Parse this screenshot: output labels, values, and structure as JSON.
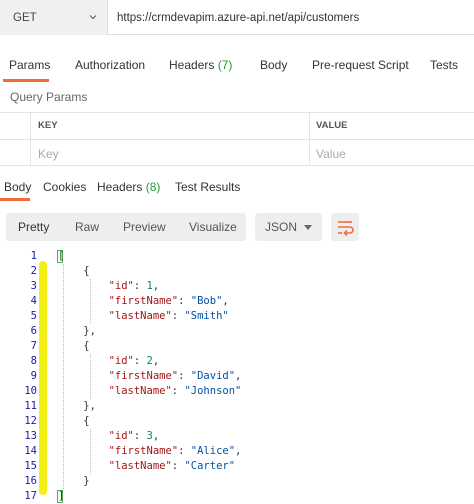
{
  "request": {
    "method": "GET",
    "url": "https://crmdevapim.azure-api.net/api/customers"
  },
  "request_tabs": [
    {
      "label": "Params"
    },
    {
      "label": "Authorization"
    },
    {
      "label": "Headers",
      "count": "(7)"
    },
    {
      "label": "Body"
    },
    {
      "label": "Pre-request Script"
    },
    {
      "label": "Tests"
    }
  ],
  "query_params": {
    "title": "Query Params",
    "columns": [
      "KEY",
      "VALUE"
    ],
    "placeholders": {
      "key": "Key",
      "value": "Value"
    }
  },
  "response_tabs": [
    {
      "label": "Body"
    },
    {
      "label": "Cookies"
    },
    {
      "label": "Headers",
      "count": "(8)"
    },
    {
      "label": "Test Results"
    }
  ],
  "view_modes": [
    "Pretty",
    "Raw",
    "Preview",
    "Visualize"
  ],
  "format": "JSON",
  "line_numbers": [
    "1",
    "2",
    "3",
    "4",
    "5",
    "6",
    "7",
    "8",
    "9",
    "10",
    "11",
    "12",
    "13",
    "14",
    "15",
    "16",
    "17"
  ],
  "customers": [
    {
      "id": 1,
      "firstName": "Bob",
      "lastName": "Smith"
    },
    {
      "id": 2,
      "firstName": "David",
      "lastName": "Johnson"
    },
    {
      "id": 3,
      "firstName": "Alice",
      "lastName": "Carter"
    }
  ],
  "colors": {
    "accent": "#f26b3a",
    "count": "#1f9b3a",
    "highlighter": "#f4f016",
    "json_key": "#a31515",
    "json_string": "#0451a5",
    "json_number": "#098658"
  }
}
